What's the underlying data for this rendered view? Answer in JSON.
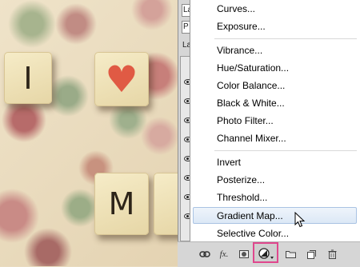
{
  "canvas": {
    "tiles": [
      {
        "text": "I"
      },
      {
        "text": "♥"
      },
      {
        "text": "M"
      }
    ]
  },
  "panel": {
    "top_field": "La",
    "second_field": "P",
    "layers_label": "La"
  },
  "adjustment_menu": {
    "items": [
      "Curves...",
      "Exposure...",
      "Vibrance...",
      "Hue/Saturation...",
      "Color Balance...",
      "Black & White...",
      "Photo Filter...",
      "Channel Mixer...",
      "Invert",
      "Posterize...",
      "Threshold...",
      "Gradient Map...",
      "Selective Color..."
    ],
    "highlighted": "Gradient Map..."
  },
  "toolbar": {
    "fx_label": "fx."
  },
  "colors": {
    "highlight_border": "#e0478d",
    "heart": "#e05a44"
  }
}
